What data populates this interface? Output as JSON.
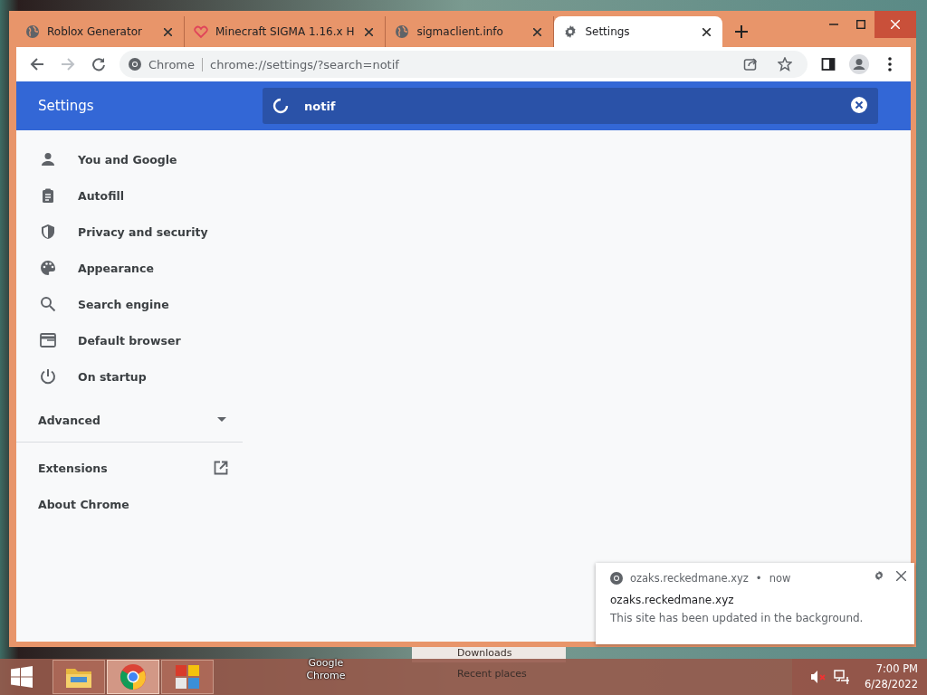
{
  "desktop": {
    "labels": [
      {
        "text": "Google Chrome",
        "kind": "shortcut"
      },
      {
        "text": "Downloads",
        "kind": "folder"
      },
      {
        "text": "Recent places",
        "kind": "folder"
      }
    ]
  },
  "browser": {
    "tabs": [
      {
        "title": "Roblox Generator",
        "kind": "globe",
        "selected": false
      },
      {
        "title": "Minecraft SIGMA 1.16.x H",
        "kind": "heart",
        "selected": false
      },
      {
        "title": "sigmaclient.info",
        "kind": "globe",
        "selected": false
      },
      {
        "title": "Settings",
        "kind": "gear",
        "selected": true
      }
    ],
    "omnibox": {
      "site_label": "Chrome",
      "url": "chrome://settings/?search=notif"
    }
  },
  "settings": {
    "title": "Settings",
    "search": {
      "value": "notif",
      "loading": true
    },
    "nav": [
      {
        "label": "You and Google",
        "kind": "person"
      },
      {
        "label": "Autofill",
        "kind": "clipboard"
      },
      {
        "label": "Privacy and security",
        "kind": "shield"
      },
      {
        "label": "Appearance",
        "kind": "palette"
      },
      {
        "label": "Search engine",
        "kind": "search"
      },
      {
        "label": "Default browser",
        "kind": "browser"
      },
      {
        "label": "On startup",
        "kind": "power"
      }
    ],
    "advanced": {
      "label": "Advanced",
      "expanded": false
    },
    "links": [
      {
        "label": "Extensions",
        "external": true
      },
      {
        "label": "About Chrome",
        "external": false
      }
    ]
  },
  "notification": {
    "origin": "ozaks.reckedmane.xyz",
    "separator": "•",
    "time": "now",
    "title": "ozaks.reckedmane.xyz",
    "body": "This site has been updated in the background."
  },
  "taskbar": {
    "apps": [
      {
        "kind": "folder",
        "selected": false
      },
      {
        "kind": "chrome",
        "selected": true
      },
      {
        "kind": "tiles",
        "selected": false
      }
    ],
    "tray": {
      "muted": true,
      "time": "7:00 PM",
      "date": "6/28/2022"
    }
  }
}
